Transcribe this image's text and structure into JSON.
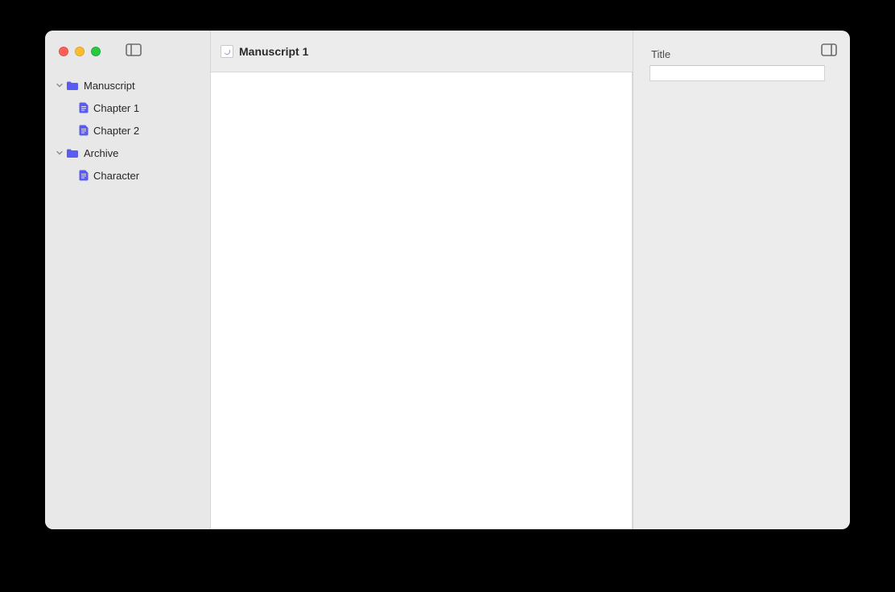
{
  "toolbar": {
    "document_title": "Manuscript 1"
  },
  "sidebar": {
    "items": [
      {
        "type": "folder",
        "label": "Manuscript",
        "expanded": true,
        "depth": 0
      },
      {
        "type": "doc",
        "label": "Chapter 1",
        "depth": 1
      },
      {
        "type": "doc",
        "label": "Chapter 2",
        "depth": 1
      },
      {
        "type": "folder",
        "label": "Archive",
        "expanded": true,
        "depth": 0
      },
      {
        "type": "doc",
        "label": "Character",
        "depth": 1
      }
    ]
  },
  "inspector": {
    "title_label": "Title",
    "title_value": ""
  }
}
